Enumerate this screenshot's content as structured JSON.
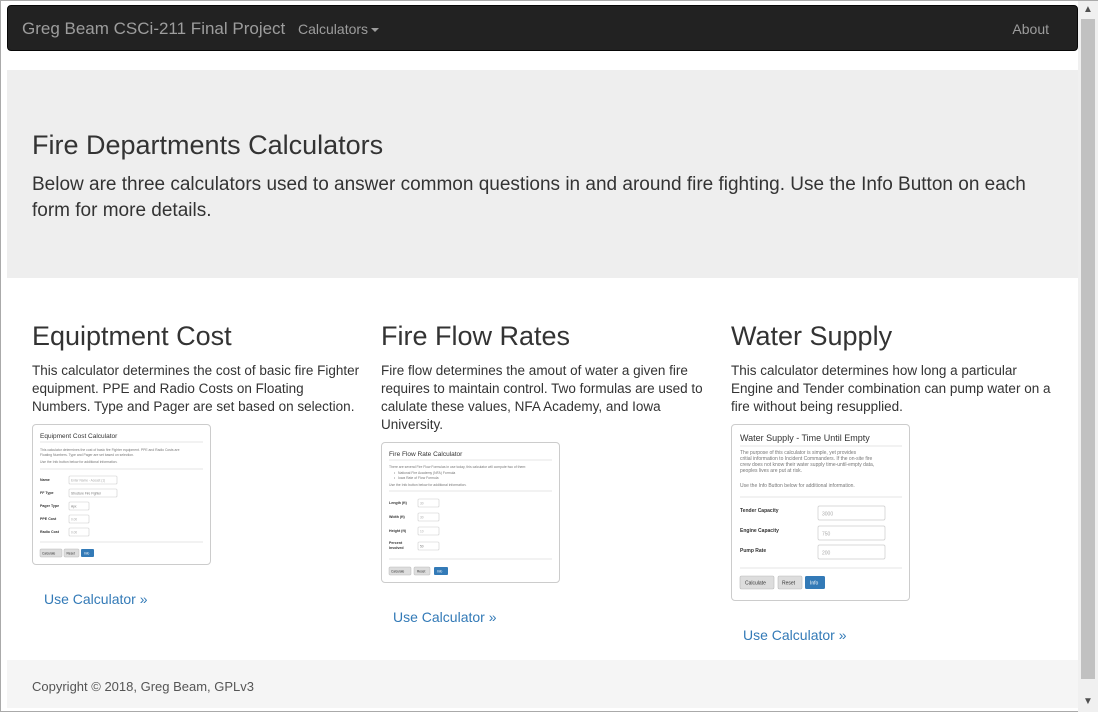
{
  "navbar": {
    "brand": "Greg Beam CSCi-211 Final Project",
    "dropdown": "Calculators",
    "about": "About"
  },
  "jumbotron": {
    "title": "Fire Departments Calculators",
    "lead": "Below are three calculators used to answer common questions in and around fire fighting. Use the Info Button on each form for more details."
  },
  "columns": [
    {
      "heading": "Equiptment Cost",
      "description": "This calculator determines the cost of basic fire Fighter equipment. PPE and Radio Costs on Floating Numbers. Type and Pager are set based on selection.",
      "link": "Use Calculator »",
      "preview": {
        "title": "Equipment Cost Calculator",
        "intro": "This calculator determines the cost of basic fire Fighter equipment. PPE and Radio Costs are Floating Numbers. Type and Pager are set based on selection.",
        "note": "Use the Info button below for additional information.",
        "fields": [
          {
            "label": "Name",
            "value": "Enter Name - Aceast (1)"
          },
          {
            "label": "FF Type",
            "value": "Structure Fire Fighter"
          },
          {
            "label": "Pager Type",
            "value": "Apx"
          },
          {
            "label": "PPE Cost",
            "value": "0.00"
          },
          {
            "label": "Radio Cost",
            "value": "0.00"
          }
        ],
        "buttons": [
          "Calculate",
          "Reset",
          "Info"
        ]
      }
    },
    {
      "heading": "Fire Flow Rates",
      "description": "Fire flow determines the amout of water a given fire requires to maintain control. Two formulas are used to calulate these values, NFA Academy, and Iowa University.",
      "link": "Use Calculator »",
      "preview": {
        "title": "Fire Flow Rate Calculator",
        "intro": "There are several Fire Flow Formulas in use today, this calculator will compute two of them:",
        "bullets": [
          "National Fire Academy (NFA) Formula",
          "Iowa Rate of Flow Formula"
        ],
        "note": "Use the Info button below for additional information.",
        "fields": [
          {
            "label": "Length (ft)",
            "value": "30"
          },
          {
            "label": "Width (ft)",
            "value": "30"
          },
          {
            "label": "Height (ft)",
            "value": "10"
          },
          {
            "label": "Percent Involved",
            "value": "50"
          }
        ],
        "buttons": [
          "Calculate",
          "Reset",
          "Info"
        ]
      }
    },
    {
      "heading": "Water Supply",
      "description": "This calculator determines how long a particular Engine and Tender combination can pump water on a fire without being resupplied.",
      "link": "Use Calculator »",
      "preview": {
        "title": "Water Supply - Time Until Empty",
        "intro": "The purpose of this calculator is simple, yet provides critial information to Incident Commanders. If the on-site fire crew does not know their water supply time-until-empty data, peoples lives are put at risk.",
        "note": "Use the Info Button below for additional information.",
        "fields": [
          {
            "label": "Tender Capacity",
            "value": "3000"
          },
          {
            "label": "Engine Capacity",
            "value": "750"
          },
          {
            "label": "Pump Rate",
            "value": "200"
          }
        ],
        "buttons": [
          "Calculate",
          "Reset",
          "Info"
        ]
      }
    }
  ],
  "footer": {
    "copyright": "Copyright © 2018, Greg Beam, GPLv3"
  },
  "scrollbar": {
    "up_glyph": "▲",
    "down_glyph": "▼"
  },
  "colors": {
    "navbar_bg": "#222222",
    "jumbotron_bg": "#eeeeee",
    "link": "#337ab7",
    "primary_button": "#337ab7"
  }
}
